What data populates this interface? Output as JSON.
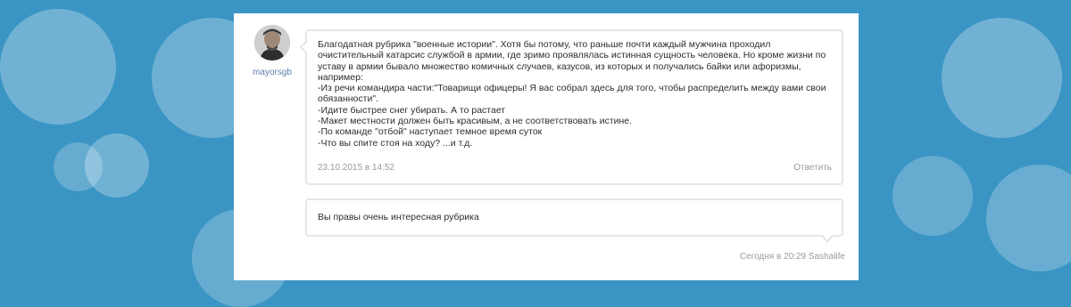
{
  "comment": {
    "author": "mayorsgb",
    "lines": [
      "Благодатная рубрика \"военные истории\". Хотя бы потому, что раньше почти каждый мужчина проходил",
      "очистительный катарсис службой в армии, где зримо проявлялась истинная сущность человека. Но кроме жизни по",
      "уставу в армии бывало множество комичных случаев, казусов, из которых и получались байки или афоризмы,",
      "например:",
      "-Из речи командира части:\"Товарищи офицеры! Я вас собрал здесь для того, чтобы распределить между вами свои",
      "обязанности\".",
      "-Идите быстрее снег убирать. А то растает",
      "-Макет местности должен быть красивым, а не соответствовать истине.",
      "-По команде \"отбой\" наступает темное время суток",
      "-Что вы спите стоя на ходу? ...и т.д."
    ],
    "date": "23.10.2015 в 14:52",
    "reply_label": "Ответить"
  },
  "reply": {
    "text": "Вы правы очень интересная рубрика",
    "meta": "Сегодня в 20:29 Sashalife"
  },
  "colors": {
    "background": "#3b95c4",
    "username": "#5a7fa8",
    "muted": "#9a9a9a"
  }
}
